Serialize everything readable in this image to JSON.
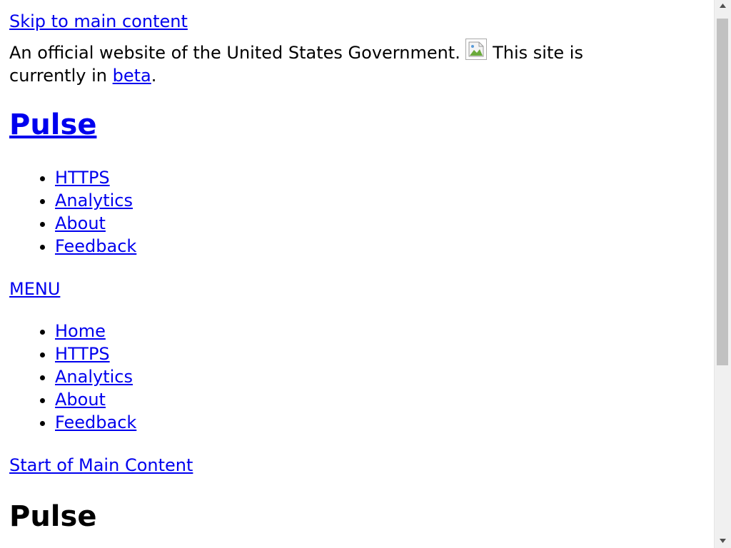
{
  "skip_link": "Skip to main content",
  "gov_banner": {
    "text": "An official website of the United States Government.",
    "beta_prefix": "This site is currently in",
    "beta_link": "beta",
    "beta_suffix": ".",
    "flag_icon": "broken-image-icon"
  },
  "site_title": "Pulse",
  "primary_nav": [
    "HTTPS",
    "Analytics",
    "About",
    "Feedback"
  ],
  "menu_toggle": "MENU",
  "secondary_nav": [
    "Home",
    "HTTPS",
    "Analytics",
    "About",
    "Feedback"
  ],
  "start_main": "Start of Main Content",
  "page_heading": "Pulse",
  "colors": {
    "link": "#0000ee",
    "text": "#000000",
    "background": "#ffffff",
    "scrollbar_thumb": "#c1c1c1"
  }
}
